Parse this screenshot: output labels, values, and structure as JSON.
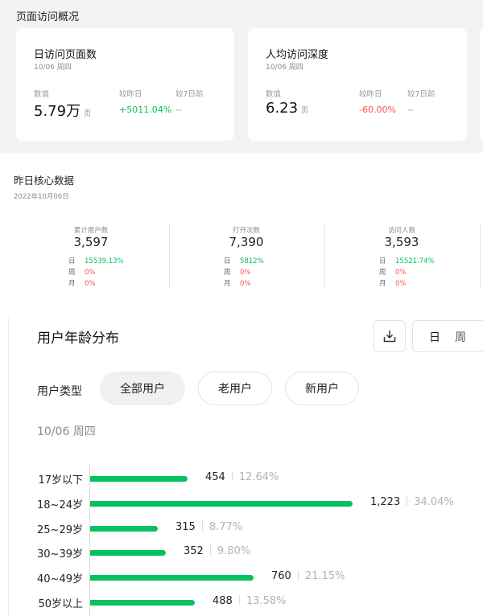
{
  "overview": {
    "title": "页面访问概况",
    "cards": [
      {
        "title": "日访问页面数",
        "date": "10/06 周四",
        "label_value": "数值",
        "label_prev_day": "较昨日",
        "label_prev_7": "较7日前",
        "value": "5.79万",
        "unit": "页",
        "prev_day": "+5011.04%",
        "prev_7": "--"
      },
      {
        "title": "人均访问深度",
        "date": "10/06 周四",
        "label_value": "数值",
        "label_prev_day": "较昨日",
        "label_prev_7": "较7日前",
        "value": "6.23",
        "unit": "页",
        "prev_day": "-60.00%",
        "prev_7": "--"
      }
    ]
  },
  "core": {
    "title": "昨日核心数据",
    "date": "2022年10月06日",
    "metrics": [
      {
        "label": "累计用户数",
        "value": "3,597",
        "day_k": "日",
        "day_v": "15539.13%",
        "week_k": "周",
        "week_v": "0%",
        "month_k": "月",
        "month_v": "0%"
      },
      {
        "label": "打开次数",
        "value": "7,390",
        "day_k": "日",
        "day_v": "5812%",
        "week_k": "周",
        "week_v": "0%",
        "month_k": "月",
        "month_v": "0%"
      },
      {
        "label": "访问人数",
        "value": "3,593",
        "day_k": "日",
        "day_v": "15521.74%",
        "week_k": "周",
        "week_v": "0%",
        "month_k": "月",
        "month_v": "0%"
      }
    ]
  },
  "age": {
    "title": "用户年龄分布",
    "download_icon": "download-icon",
    "period_day": "日",
    "period_week": "周",
    "user_type_label": "用户类型",
    "user_types": [
      "全部用户",
      "老用户",
      "新用户"
    ],
    "date": "10/06 周四",
    "colors": {
      "bar": "#07c160"
    }
  },
  "chart_data": {
    "type": "bar",
    "orientation": "horizontal",
    "categories": [
      "17岁以下",
      "18~24岁",
      "25~29岁",
      "30~39岁",
      "40~49岁",
      "50岁以上"
    ],
    "values": [
      454,
      1223,
      315,
      352,
      760,
      488
    ],
    "value_labels": [
      "454",
      "1,223",
      "315",
      "352",
      "760",
      "488"
    ],
    "percent_labels": [
      "12.64%",
      "34.04%",
      "8.77%",
      "9.80%",
      "21.15%",
      "13.58%"
    ],
    "xlim": [
      0,
      1223
    ]
  }
}
